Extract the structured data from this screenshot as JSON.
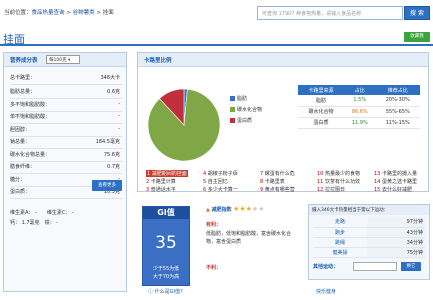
{
  "breadcrumb": {
    "prefix": "当前位置：",
    "home": "食品热量查询",
    "sep1": " > ",
    "category": "谷物薯类",
    "sep2": " > ",
    "current": "挂面"
  },
  "search": {
    "placeholder": "可查询 17907 种食物热量，请输入食品名称",
    "button": "搜 索"
  },
  "page_title": "挂面",
  "collect_button": "收藏我",
  "left": {
    "title": "营养成分表",
    "select": "每100克",
    "rows": [
      {
        "label": "总卡路里：",
        "value": "346大卡"
      },
      {
        "label": "脂肪总量：",
        "value": "0.6克"
      },
      {
        "label": "多不饱和脂肪酸：",
        "value": "-"
      },
      {
        "label": "单不饱和脂肪酸：",
        "value": "-"
      },
      {
        "label": "胆固醇：",
        "value": "-"
      },
      {
        "label": "钠总量：",
        "value": "184.5毫克"
      },
      {
        "label": "碳水化合物总量：",
        "value": "75.6克"
      },
      {
        "label": "膳食纤维：",
        "value": "0.7克"
      },
      {
        "label": "糖分：",
        "value": "-"
      },
      {
        "label": "蛋白质：",
        "value": "10.3克"
      }
    ],
    "vitamins": {
      "a_label": "维生素A：",
      "a_value": "-",
      "c_label": "维生素C：",
      "c_value": "-",
      "b1_label": "钙：",
      "b1_value": "1.7毫克",
      "fe_label": "铁：",
      "fe_value": "-"
    },
    "more_button": "查看更多"
  },
  "calorie": {
    "title": "卡路里比例",
    "legend": [
      {
        "label": "脂肪",
        "color": "#3a6fc1"
      },
      {
        "label": "碳水化合物",
        "color": "#7fa745"
      },
      {
        "label": "蛋白质",
        "color": "#c0303a"
      }
    ],
    "pie": [
      {
        "name": "脂肪",
        "value": 1.5,
        "color": "#3a6fc1"
      },
      {
        "name": "碳水化合物",
        "value": 86.6,
        "color": "#7fa745"
      },
      {
        "name": "蛋白质",
        "value": 11.9,
        "color": "#c0303a"
      }
    ],
    "table": {
      "headers": [
        "卡路里来源",
        "占比",
        "推荐占比"
      ],
      "rows": [
        [
          "脂肪",
          "1.5%",
          "20%-30%"
        ],
        [
          "碳水化合物",
          "86.6%",
          "55%-65%"
        ],
        [
          "蛋白质",
          "11.9%",
          "11%-15%"
        ]
      ]
    }
  },
  "tags": [
    {
      "n": "1",
      "t": "减肥期间的挂面"
    },
    {
      "n": "4",
      "t": "胡椒子粉子佰"
    },
    {
      "n": "7",
      "t": "螺蛋有什么危"
    },
    {
      "n": "10",
      "t": "热量最少的食物"
    },
    {
      "n": "13",
      "t": "卡路里的摄入量"
    },
    {
      "n": "2",
      "t": "卡路里计算"
    },
    {
      "n": "5",
      "t": "自主回忆"
    },
    {
      "n": "8",
      "t": "卡路里表"
    },
    {
      "n": "11",
      "t": "饮茶有什么功效"
    },
    {
      "n": "14",
      "t": "蛋黄之选卡路里"
    },
    {
      "n": "3",
      "t": "普通话水平"
    },
    {
      "n": "6",
      "t": "多少大卡算一"
    },
    {
      "n": "9",
      "t": "黄点有哪些营"
    },
    {
      "n": "12",
      "t": "拉拉图日"
    },
    {
      "n": "15",
      "t": "去什么好减肥"
    }
  ],
  "gi": {
    "title": "GI值",
    "value": "35",
    "line1": "少于55为低",
    "line2": "大于70为高",
    "link": "什么是GI值?"
  },
  "evaluation": {
    "label": "减肥指数",
    "stars": 3,
    "good_label": "有利：",
    "good_text": "低脂肪，低饱和脂肪酸，富含碳水化合物，富含蛋白质",
    "bad_label": "不利：",
    "bad_text": ""
  },
  "sport": {
    "title": "摄入346大卡热量相当于需以下运动：",
    "rows": [
      [
        "走路",
        "97分钟"
      ],
      [
        "跑步",
        "43分钟"
      ],
      [
        "跳绳",
        "34分钟"
      ],
      [
        "健美操",
        "75分钟"
      ]
    ],
    "other_label": "其他运动：",
    "btn": "换它"
  },
  "footer": {
    "text": "快乐健身"
  }
}
